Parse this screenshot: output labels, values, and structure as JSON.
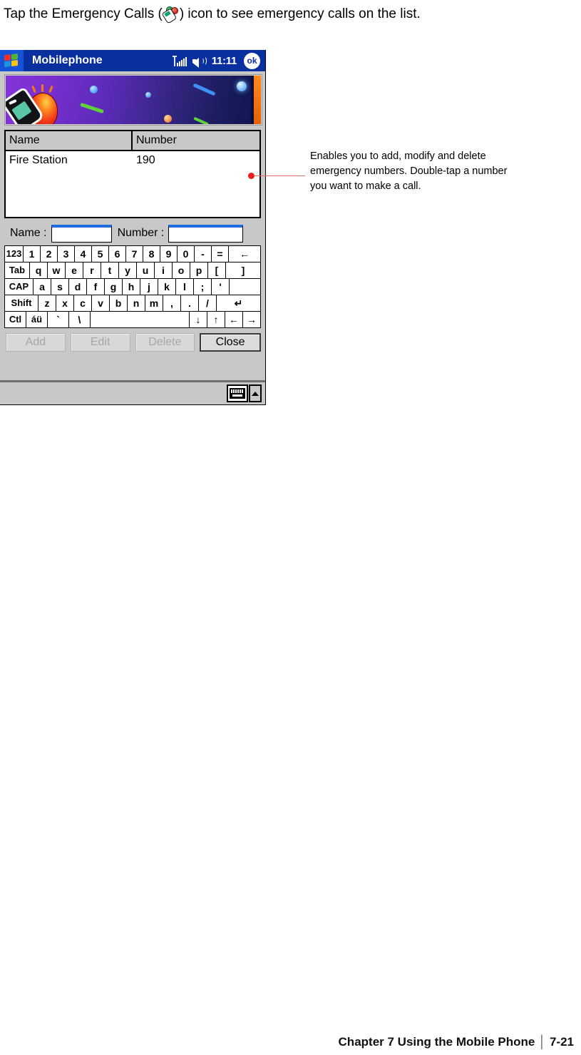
{
  "intro": {
    "before": "Tap the Emergency Calls (",
    "icon": "emergency-calls-icon",
    "after": ") icon to see emergency calls on the list."
  },
  "pda": {
    "titlebar": {
      "start_icon": "windows-flag-icon",
      "app_title": "Mobilephone",
      "signal_icon": "signal-strength-icon",
      "volume_icon": "speaker-icon",
      "clock": "11:11",
      "ok_label": "ok"
    },
    "banner": {
      "alt": "emergency-phone-siren-banner"
    },
    "list": {
      "columns": [
        "Name",
        "Number"
      ],
      "rows": [
        {
          "name": "Fire Station",
          "number": "190"
        }
      ]
    },
    "fields": {
      "name_label": "Name :",
      "name_value": "",
      "number_label": "Number :",
      "number_value": ""
    },
    "keyboard": {
      "rows": [
        [
          "123",
          "1",
          "2",
          "3",
          "4",
          "5",
          "6",
          "7",
          "8",
          "9",
          "0",
          "-",
          "=",
          "←"
        ],
        [
          "Tab",
          "q",
          "w",
          "e",
          "r",
          "t",
          "y",
          "u",
          "i",
          "o",
          "p",
          "[",
          "]"
        ],
        [
          "CAP",
          "a",
          "s",
          "d",
          "f",
          "g",
          "h",
          "j",
          "k",
          "l",
          ";",
          "'",
          ""
        ],
        [
          "Shift",
          "z",
          "x",
          "c",
          "v",
          "b",
          "n",
          "m",
          ",",
          ".",
          "/",
          "↵"
        ],
        [
          "Ctl",
          "áü",
          "`",
          "\\",
          " ",
          "↓",
          "↑",
          "←",
          "→"
        ]
      ]
    },
    "buttons": {
      "add": "Add",
      "edit": "Edit",
      "delete": "Delete",
      "close": "Close"
    },
    "taskbar": {
      "keyboard_icon": "soft-keyboard-icon",
      "up_icon": "chevron-up-icon"
    }
  },
  "callout": {
    "text": "Enables you to add, modify and delete emergency numbers. Double-tap a number you want to make a call.",
    "color": "#ee1c1c"
  },
  "footer": {
    "chapter": "Chapter 7 Using the Mobile Phone",
    "separator": "│",
    "page": "7-21"
  }
}
